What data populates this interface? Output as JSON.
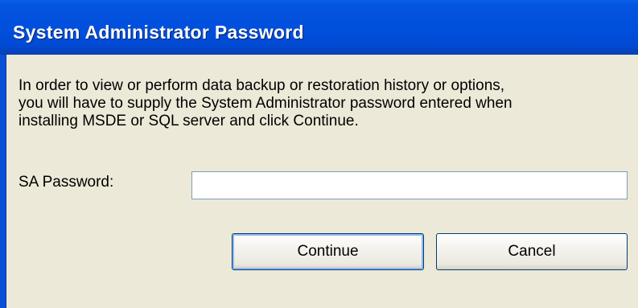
{
  "dialog": {
    "title": "System Administrator Password",
    "message_lines": [
      "In order to view or perform data backup or restoration history or options,",
      "you will have to supply the System Administrator password entered when",
      "installing MSDE or SQL server and click Continue."
    ]
  },
  "form": {
    "password_label": "SA Password:",
    "password_value": ""
  },
  "buttons": {
    "continue_label": "Continue",
    "cancel_label": "Cancel"
  },
  "colors": {
    "titlebar": "#0150dd",
    "title_text": "#ffffff",
    "dialog_background": "#ece9d8",
    "input_border": "#7f9db9",
    "button_border": "#003c74"
  }
}
